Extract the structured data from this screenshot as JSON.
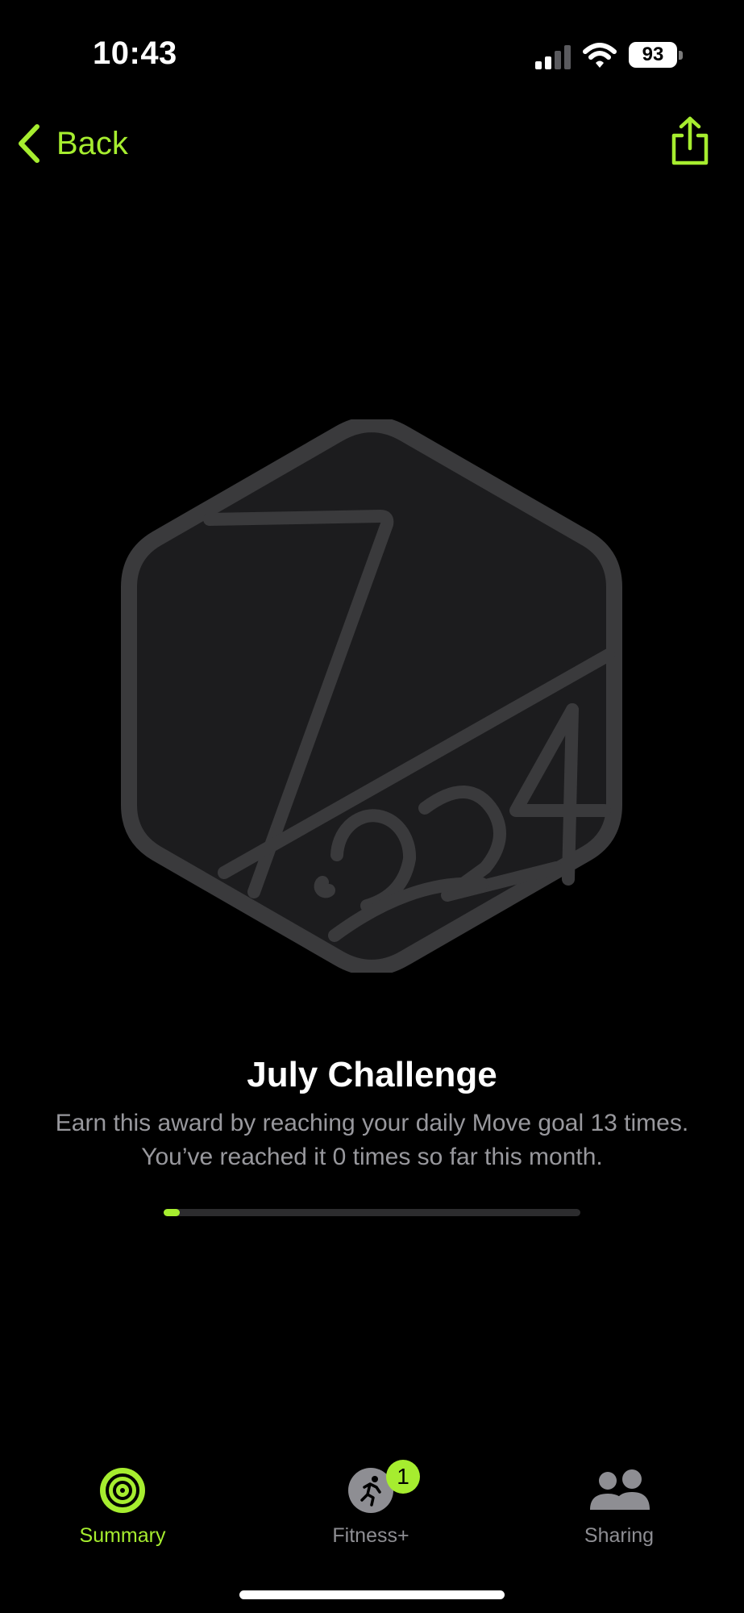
{
  "status_bar": {
    "time": "10:43",
    "battery_level": "93"
  },
  "nav": {
    "back_label": "Back",
    "share_icon": "share-icon"
  },
  "award": {
    "icon": "july-2024-hexagon-badge",
    "title": "July Challenge",
    "description_line1": "Earn this award by reaching your daily Move goal 13 times.",
    "description_line2": "You’ve reached it 0 times so far this month.",
    "progress_current": 0,
    "progress_goal": 13
  },
  "tabs": [
    {
      "label": "Summary",
      "icon": "activity-rings-icon",
      "selected": true
    },
    {
      "label": "Fitness+",
      "icon": "running-figure-icon",
      "selected": false,
      "badge": "1"
    },
    {
      "label": "Sharing",
      "icon": "people-icon",
      "selected": false
    }
  ],
  "colors": {
    "accent": "#a6ed2f",
    "background": "#000000",
    "badge_fill": "#1c1c1e",
    "badge_stroke": "#3a3a3c",
    "secondary_text": "#98989d"
  }
}
